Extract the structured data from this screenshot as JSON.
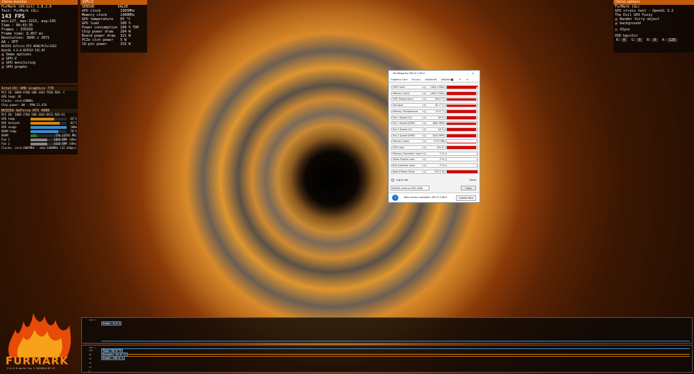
{
  "demo_monitor": {
    "title": "Demo monitor",
    "app_line": "FurMark (64-bit) 2.8.2.0",
    "test_line": "Test: FurMark (GL)",
    "fps": "143 FPS",
    "stats": "min:127, max:3215, avg:145",
    "rows": [
      "Time      : 00:43:35",
      "Frames    : 370169",
      "Frame time: 6.857 ms",
      "Resolution: 3840 x 2071",
      "AA        : OFF"
    ],
    "gpu_lines": [
      "NVIDIA GeForce RTX 4080/PCIe/SSE2",
      "OpenGL 4.6.0 NVIDIA 561.09"
    ],
    "options": [
      "Demo options",
      "GPU-Z",
      "GPU monitoring",
      "GPU graphs"
    ]
  },
  "gpu1": {
    "title": "Intel(R) UHD Graphics 770",
    "rows": [
      "PCI ID: 8086-A780 SUB-1462-7D36 REV: C",
      "GPU temp: 0C",
      "Clocks: core:450MHz",
      "Chip power: 0W - PPW:11.478"
    ]
  },
  "gpu2": {
    "title": "NVIDIA GeForce RTX 4080",
    "pci": "PCI ID: 10DE-2704 SUB-1043-8913 REV:A1",
    "bars": [
      {
        "label": "GPU temp",
        "value": "65°C",
        "fill": 0.65,
        "color": "#d4860e"
      },
      {
        "label": "GPU hotspot",
        "value": "81°C",
        "fill": 0.81,
        "color": "#d4860e"
      },
      {
        "label": "GPU usage",
        "value": "100%",
        "fill": 1.0,
        "color": "#3a8fd0"
      },
      {
        "label": "VRAM temp",
        "value": "76°C",
        "fill": 0.76,
        "color": "#3a8fd0"
      },
      {
        "label": "VRAM",
        "value": "17% (2702 MB)",
        "fill": 0.17,
        "color": "#2e7a30"
      },
      {
        "label": "Fan 1",
        "value": "1860 RPM (46%)",
        "fill": 0.46,
        "color": "#888"
      },
      {
        "label": "Fan 2",
        "value": "1610 RPM (46%)",
        "fill": 0.46,
        "color": "#888"
      }
    ],
    "clocks": "Clocks: core:2805MHz - mem:1400MHz (22.4Gbps)"
  },
  "gpuz": {
    "title": "GPU-Z",
    "headers": [
      "SENSOR",
      "VALUE"
    ],
    "rows": [
      [
        "GPU clock",
        "1905MHz"
      ],
      [
        "Memory clock",
        "1400MHz"
      ],
      [
        "GPU temperature",
        "65 °C"
      ],
      [
        "GPU load",
        "100 %"
      ],
      [
        "Power consumption",
        "100 % TDP"
      ],
      [
        "Chip power draw",
        "284 W"
      ],
      [
        "Board power draw",
        "321 W"
      ],
      [
        "PCIe slot power",
        "5 W"
      ],
      [
        "16-pin power",
        "315 W"
      ]
    ]
  },
  "demo_options": {
    "title": "Demo options",
    "app": "FurMark (GL)",
    "desc": "GPU stress test - OpenGL 3.2",
    "fuzzy": "The Evil GPU Fuzzy",
    "checks": [
      "Render furry object",
      "background"
    ],
    "vsync": "VSync",
    "osd_label": "OSD bgcolor",
    "osd": [
      {
        "k": "R:",
        "v": "0"
      },
      {
        "k": "G:",
        "v": "0"
      },
      {
        "k": "B:",
        "v": "0"
      },
      {
        "k": "A:",
        "v": "128"
      }
    ]
  },
  "techpowerup": {
    "title": "TechPowerUp GPU-Z 2.65.0",
    "tabs": [
      "Graphics Card",
      "Sensors",
      "Advanced",
      "Validation"
    ],
    "sensors": [
      {
        "name": "GPU Clock",
        "value": "1905.0 MHz",
        "fill": 0.95
      },
      {
        "name": "Memory Clock",
        "value": "1400.2 MHz",
        "fill": 0.95
      },
      {
        "name": "GPU Temperature",
        "value": "66.0 °C",
        "fill": 0.9
      },
      {
        "name": "Hot Spot",
        "value": "81.7 °C",
        "fill": 0.9
      },
      {
        "name": "Memory Temperature",
        "value": "74.0 °C",
        "fill": 0.9
      },
      {
        "name": "Fan 1 Speed (%)",
        "value": "46 %",
        "fill": 0.9
      },
      {
        "name": "Fan 1 Speed (RPM)",
        "value": "1862 RPM",
        "fill": 0.9
      },
      {
        "name": "Fan 2 Speed (%)",
        "value": "46 %",
        "fill": 0.9
      },
      {
        "name": "Fan 2 Speed (RPM)",
        "value": "1610 RPM",
        "fill": 0.9
      },
      {
        "name": "Memory Used",
        "value": "2771 MB",
        "fill": 0.04
      },
      {
        "name": "GPU Load",
        "value": "100 %",
        "fill": 1.0
      },
      {
        "name": "Memory Controller Load",
        "value": "0 %",
        "fill": 0
      },
      {
        "name": "Video Engine Load",
        "value": "0 %",
        "fill": 0
      },
      {
        "name": "Bus Interface Load",
        "value": "0 %",
        "fill": 0
      },
      {
        "name": "Board Power Draw",
        "value": "313.2 W",
        "fill": 1.0
      }
    ],
    "log": "Log to file",
    "reset": "Reset",
    "select": "NVIDIA GeForce RTX 4080",
    "close": "Close",
    "update_msg": "New version available: GPU-Z 2.66.0",
    "update_btn": "Update Now"
  },
  "graphs": {
    "g1_label": "GPU 0",
    "g1_tag": "Usage: 0.0 %",
    "g2_label": "GPU 1",
    "g2_tags": [
      "Temp: 65.0 °C",
      "Hotspot: 81.6 °C",
      "Usage: 100.0 %"
    ],
    "axis": [
      "100",
      "80",
      "60",
      "40",
      "20",
      "0"
    ]
  },
  "logo": {
    "name": "FURMARK",
    "build": "2.8.2.0 build Jun 2 2025@14:07:17"
  }
}
